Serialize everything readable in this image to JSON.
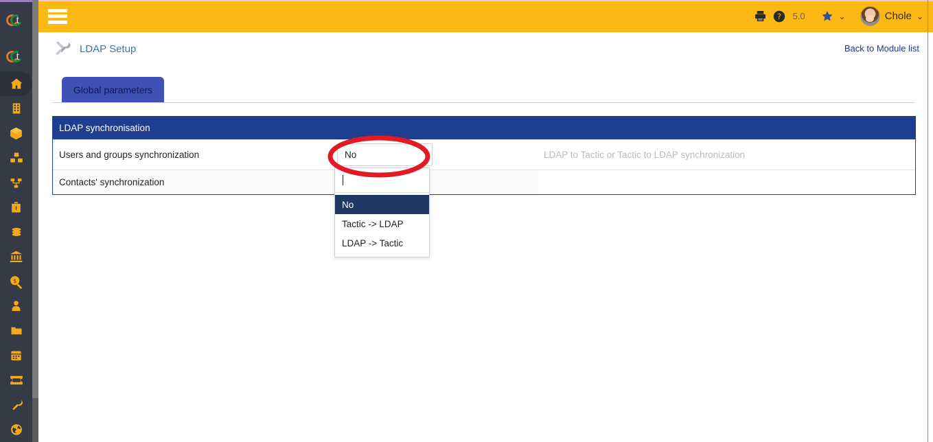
{
  "app": {
    "accent_yellow": "#fdb913",
    "rail_bg": "#343a46",
    "panel_blue": "#1e3f8f",
    "tab_blue": "#3f51b5",
    "annotation_color": "#e01b24"
  },
  "sidebar": {
    "logo_letter": "t",
    "items": [
      {
        "icon": "home-icon",
        "label": "Home",
        "active": true
      },
      {
        "icon": "building-icon",
        "label": "Third parties",
        "active": false
      },
      {
        "icon": "box-icon",
        "label": "Products",
        "active": false
      },
      {
        "icon": "stock-boxes-icon",
        "label": "Stock",
        "active": false
      },
      {
        "icon": "sitemap-icon",
        "label": "Manufacturing orders",
        "active": false
      },
      {
        "icon": "briefcase-icon",
        "label": "Commercial",
        "active": false
      },
      {
        "icon": "coins-icon",
        "label": "Billing",
        "active": false
      },
      {
        "icon": "bank-icon",
        "label": "Bank",
        "active": false
      },
      {
        "icon": "magnifier-dollar-icon",
        "label": "Accounting",
        "active": false
      },
      {
        "icon": "user-icon",
        "label": "HRM",
        "active": false
      },
      {
        "icon": "folder-icon",
        "label": "Projects",
        "active": false
      },
      {
        "icon": "calendar-icon",
        "label": "Agenda",
        "active": false
      },
      {
        "icon": "ticket-icon",
        "label": "Tickets",
        "active": false
      },
      {
        "icon": "wrench-icon",
        "label": "Tools",
        "active": false
      },
      {
        "icon": "globe-icon",
        "label": "Website",
        "active": false
      }
    ]
  },
  "topbar": {
    "menu_icon": "hamburger-icon",
    "print_icon": "printer-icon",
    "help_icon": "help-circle-icon",
    "version": "5.0",
    "bookmark_icon": "star-icon",
    "bookmark_chevron": "⌄",
    "user_name": "Chole",
    "user_chevron": "⌄",
    "avatar_icon": "avatar"
  },
  "page": {
    "tools_icon": "tools-icon",
    "title": "LDAP Setup",
    "back_link": "Back to Module list"
  },
  "tabs": [
    {
      "label": "Global parameters",
      "active": true
    }
  ],
  "table": {
    "header": "LDAP synchronisation",
    "rows": [
      {
        "label": "Users and groups synchronization",
        "value": "No",
        "help": "LDAP to Tactic or Tactic to LDAP synchronization"
      },
      {
        "label": "Contacts' synchronization",
        "value": "",
        "help": ""
      }
    ]
  },
  "dropdown": {
    "open": true,
    "search_value": "",
    "search_placeholder": "",
    "options": [
      {
        "label": "No",
        "selected": true
      },
      {
        "label": "Tactic -> LDAP",
        "selected": false
      },
      {
        "label": "LDAP -> Tactic",
        "selected": false
      }
    ]
  },
  "annotation": {
    "shape": "ellipse",
    "color": "#e01b24",
    "target": "Users and groups synchronization select"
  }
}
